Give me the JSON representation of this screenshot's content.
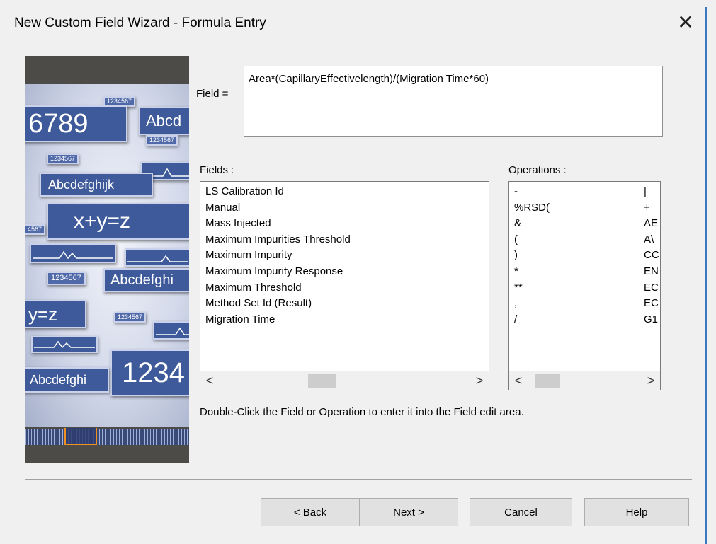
{
  "window": {
    "title": "New Custom Field Wizard - Formula Entry",
    "close_glyph": "✕"
  },
  "wizard_image": {
    "tiles": [
      "6789",
      "Abcd",
      "Abcdefghijk",
      "x+y=z",
      "Abcdefghi",
      "y=z",
      "1234",
      "Abcdefghi",
      "1234567",
      "1234567",
      "1234567",
      "1234567",
      "4567"
    ]
  },
  "field": {
    "label": "Field =",
    "value": "Area*(CapillaryEffectivelength)/(Migration Time*60)"
  },
  "fields_list": {
    "label": "Fields :",
    "items": [
      "LS Calibration Id",
      "Manual",
      "Mass Injected",
      "Maximum Impurities Threshold",
      "Maximum Impurity",
      "Maximum Impurity Response",
      "Maximum Threshold",
      "Method Set Id (Result)",
      "Migration Time"
    ]
  },
  "operations_list": {
    "label": "Operations :",
    "left_column": [
      "-",
      "%RSD(",
      "&",
      "(",
      ")",
      "*",
      "**",
      ",",
      "/"
    ],
    "right_column": [
      "|",
      "+",
      "AE",
      "A\\",
      "CC",
      "EN",
      "EC",
      "EC",
      "G1"
    ]
  },
  "scroll": {
    "left_arrow": "<",
    "right_arrow": ">"
  },
  "hint": "Double-Click the Field or Operation to enter it into the Field edit area.",
  "buttons": {
    "back": "< Back",
    "next": "Next >",
    "cancel": "Cancel",
    "help": "Help"
  }
}
